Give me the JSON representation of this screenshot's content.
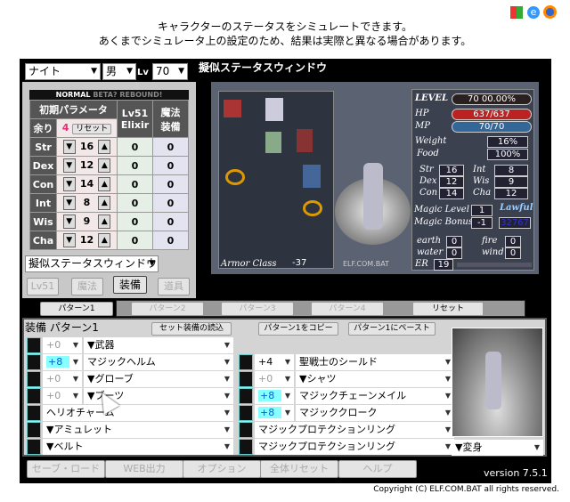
{
  "header": {
    "line1": "キャラクターのステータスをシミュレートできます。",
    "line2": "あくまでシミュレータ上の設定のため、結果は実際と異なる場合があります。"
  },
  "top_icons": [
    "windows-icon",
    "ie-icon",
    "firefox-icon"
  ],
  "selectors": {
    "class": "ナイト",
    "gender": "男",
    "lv_label": "Lv",
    "level": "70"
  },
  "mode_bar": {
    "normal": "NORMAL",
    "beta": "BETA?",
    "rebound": "REBOUND!"
  },
  "stats_table": {
    "header_initial": "初期パラメータ",
    "header_lv51": "Lv51",
    "header_elixir": "Elixir",
    "header_magic": "魔法",
    "header_equip": "装備",
    "remain_label": "余り",
    "remain_value": "4",
    "reset_label": "リセット",
    "rows": [
      {
        "name": "Str",
        "value": "16",
        "elixir": "0",
        "equip": "0"
      },
      {
        "name": "Dex",
        "value": "12",
        "elixir": "0",
        "equip": "0"
      },
      {
        "name": "Con",
        "value": "14",
        "elixir": "0",
        "equip": "0"
      },
      {
        "name": "Int",
        "value": "8",
        "elixir": "0",
        "equip": "0"
      },
      {
        "name": "Wis",
        "value": "9",
        "elixir": "0",
        "equip": "0"
      },
      {
        "name": "Cha",
        "value": "12",
        "elixir": "0",
        "equip": "0"
      }
    ]
  },
  "window_select": "擬似ステータスウィンドウ",
  "left_tabs": [
    "Lv51",
    "魔法",
    "装備",
    "道具"
  ],
  "status_window": {
    "title": "擬似ステータスウィンドウ",
    "armor_class_label": "Armor Class",
    "armor_class": "-37",
    "watermark": "ELF.COM.BAT",
    "level_label": "LEVEL",
    "level": "70 00.00%",
    "hp_label": "HP",
    "hp": "637/637",
    "mp_label": "MP",
    "mp": "70/70",
    "weight_label": "Weight",
    "weight": "16%",
    "food_label": "Food",
    "food": "100%",
    "str": "16",
    "dex": "12",
    "con": "14",
    "int": "8",
    "wis": "9",
    "cha": "12",
    "magic_level_label": "Magic Level",
    "magic_level": "1",
    "magic_bonus_label": "Magic Bonus",
    "magic_bonus": "-1",
    "alignment": "Lawful",
    "alignment_value": "32767",
    "earth": "0",
    "water": "0",
    "fire": "0",
    "wind": "0",
    "er_label": "ER",
    "er": "19"
  },
  "pattern_tabs": [
    "パターン1",
    "パターン2",
    "パターン3",
    "パターン4"
  ],
  "pattern_reset": "リセット",
  "equip": {
    "title": "装備 パターン1",
    "load_set": "セット装備の読込",
    "copy": "パターン1をコピー",
    "paste": "パターン1にペースト",
    "left": [
      {
        "plus": "+0",
        "name": "▼武器",
        "active": false
      },
      {
        "plus": "+8",
        "name": "マジックヘルム",
        "active": true
      },
      {
        "plus": "+0",
        "name": "▼グローブ",
        "active": false
      },
      {
        "plus": "+0",
        "name": "▼ブーツ",
        "active": false
      },
      {
        "plus": "",
        "name": "ヘリオチャーム"
      },
      {
        "plus": "",
        "name": "▼アミュレット"
      },
      {
        "plus": "",
        "name": "▼ベルト"
      }
    ],
    "right": [
      {
        "plus": "+4",
        "name": "聖戦士のシールド",
        "active": true
      },
      {
        "plus": "+0",
        "name": "▼シャツ",
        "active": false
      },
      {
        "plus": "+8",
        "name": "マジックチェーンメイル",
        "active": true
      },
      {
        "plus": "+8",
        "name": "マジッククローク",
        "active": true
      },
      {
        "plus": "",
        "name": "マジックプロテクションリング"
      },
      {
        "plus": "",
        "name": "マジックプロテクションリング"
      }
    ],
    "polymorph": "▼変身"
  },
  "bottom_buttons": [
    "セーブ・ロード",
    "WEB出力",
    "オプション",
    "全体リセット",
    "ヘルプ"
  ],
  "version": "version 7.5.1",
  "copyright": "Copyright (C) ELF.COM.BAT all rights reserved."
}
